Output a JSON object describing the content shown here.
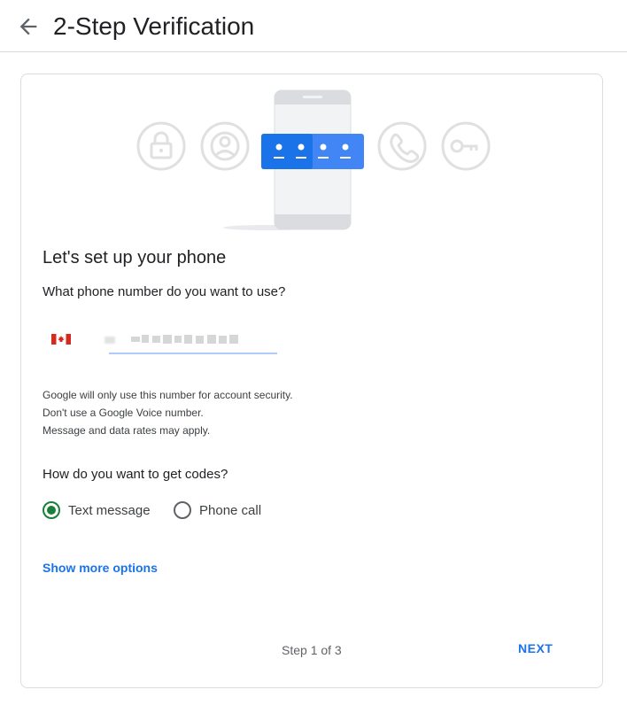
{
  "header": {
    "back_icon": "arrow-back-icon",
    "title": "2-Step Verification"
  },
  "illustration": {
    "icons": [
      "lock-icon",
      "person-icon",
      "phone-handset-icon",
      "key-icon"
    ],
    "accent": "#4285f4",
    "code_mask": "••••"
  },
  "setup": {
    "heading": "Let's set up your phone",
    "question": "What phone number do you want to use?",
    "country_flag": "canada-flag-icon",
    "notes": [
      "Google will only use this number for account security.",
      "Don't use a Google Voice number.",
      "Message and data rates may apply."
    ]
  },
  "codes": {
    "question": "How do you want to get codes?",
    "options": [
      {
        "label": "Text message",
        "selected": true
      },
      {
        "label": "Phone call",
        "selected": false
      }
    ]
  },
  "footer": {
    "show_more": "Show more options",
    "step": "Step 1 of 3",
    "next": "NEXT"
  },
  "colors": {
    "link": "#1a73e8",
    "radio_selected": "#188038",
    "border": "#dadce0"
  }
}
